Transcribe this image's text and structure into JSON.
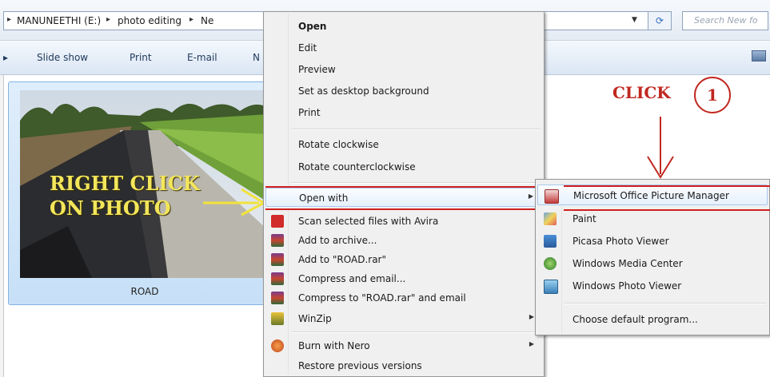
{
  "address_bar": {
    "crumbs": [
      "MANUNEETHI (E:)",
      "photo editing",
      "Ne"
    ],
    "search_placeholder": "Search New fo"
  },
  "command_bar": {
    "items": [
      "Slide show",
      "Print",
      "E-mail",
      "N"
    ]
  },
  "file": {
    "name": "ROAD"
  },
  "annotations": {
    "right_click": "RIGHT CLICK\nON PHOTO",
    "click": "CLICK",
    "step_number": "1",
    "arrow_color": "#f2e23a",
    "mark_color": "#d21f1f"
  },
  "context_menu": {
    "items": [
      {
        "label": "Open",
        "bold": true
      },
      {
        "label": "Edit"
      },
      {
        "label": "Preview"
      },
      {
        "label": "Set as desktop background"
      },
      {
        "label": "Print"
      },
      {
        "label": "Rotate clockwise"
      },
      {
        "label": "Rotate counterclockwise"
      },
      {
        "label": "Open with",
        "submenu": true
      },
      {
        "label": "Scan selected files with Avira",
        "icon": "avira-icon"
      },
      {
        "label": "Add to archive...",
        "icon": "winrar-icon"
      },
      {
        "label": "Add to \"ROAD.rar\"",
        "icon": "winrar-icon"
      },
      {
        "label": "Compress and email...",
        "icon": "winrar-icon"
      },
      {
        "label": "Compress to \"ROAD.rar\" and email",
        "icon": "winrar-icon"
      },
      {
        "label": "WinZip",
        "icon": "winzip-icon",
        "submenu": true
      },
      {
        "label": "Burn with Nero",
        "icon": "nero-icon",
        "submenu": true
      },
      {
        "label": "Restore previous versions"
      }
    ]
  },
  "open_with_submenu": {
    "items": [
      {
        "label": "Microsoft Office Picture Manager",
        "icon": "picture-manager-icon"
      },
      {
        "label": "Paint",
        "icon": "paint-icon"
      },
      {
        "label": "Picasa Photo Viewer",
        "icon": "picasa-icon"
      },
      {
        "label": "Windows Media Center",
        "icon": "media-center-icon"
      },
      {
        "label": "Windows Photo Viewer",
        "icon": "photo-viewer-icon"
      },
      {
        "label": "Choose default program..."
      }
    ]
  }
}
